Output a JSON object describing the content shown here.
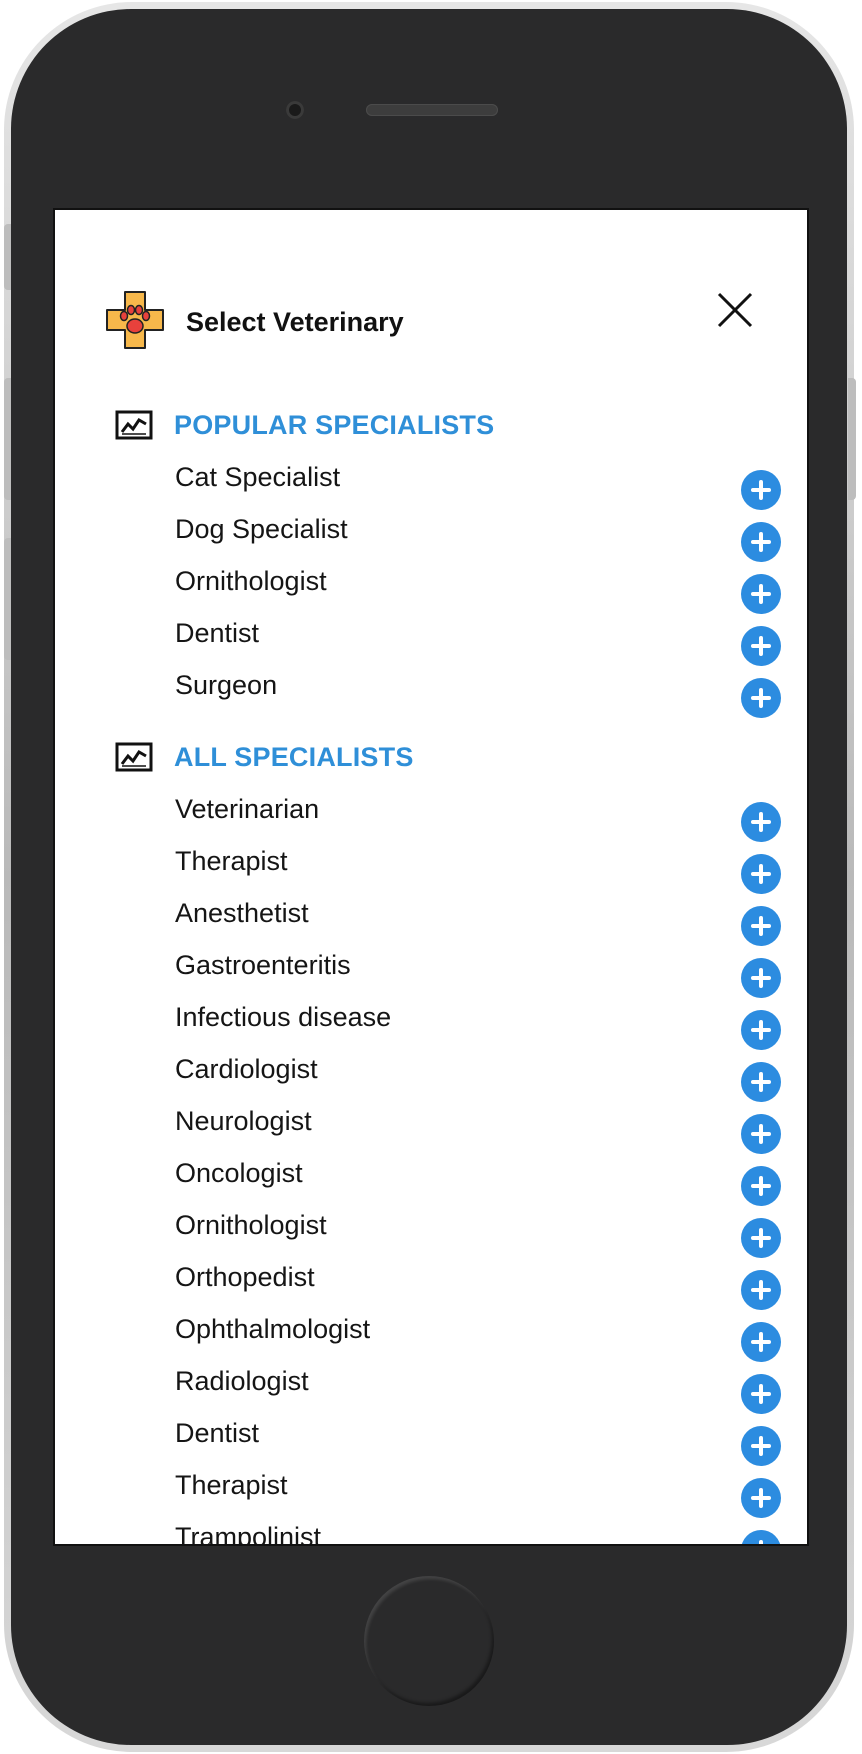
{
  "header": {
    "title": "Select Veterinary",
    "logo_icon": "paw-cross-icon",
    "close_icon": "close-icon"
  },
  "colors": {
    "accent": "#2f8fd8",
    "add_button": "#2c8ce0",
    "logo_fill": "#f7b84b",
    "paw": "#e8413c"
  },
  "sections": [
    {
      "title": "POPULAR SPECIALISTS",
      "icon": "activity-chart-icon",
      "items": [
        "Cat Specialist",
        "Dog Specialist",
        "Ornithologist",
        "Dentist",
        "Surgeon"
      ]
    },
    {
      "title": "ALL SPECIALISTS",
      "icon": "activity-chart-icon",
      "items": [
        "Veterinarian",
        "Therapist",
        "Anesthetist",
        "Gastroenteritis",
        "Infectious disease",
        "Cardiologist",
        "Neurologist",
        "Oncologist",
        "Ornithologist",
        "Orthopedist",
        "Ophthalmologist",
        "Radiologist",
        "Dentist",
        "Therapist",
        "Trampolinist"
      ]
    }
  ]
}
